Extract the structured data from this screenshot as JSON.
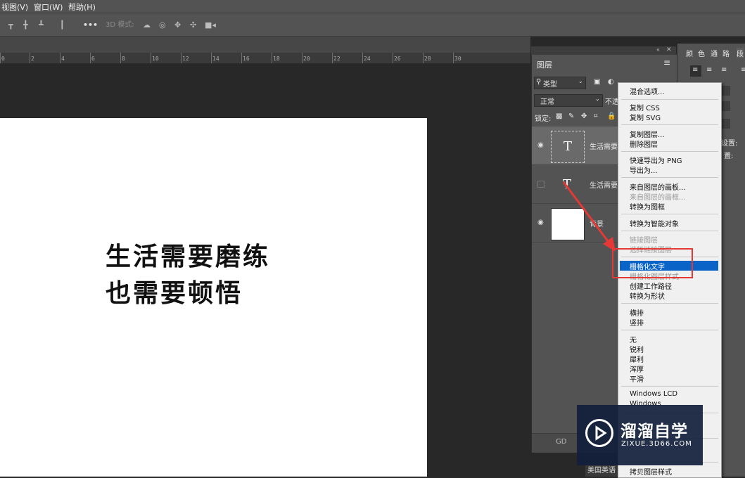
{
  "menubar": {
    "items": [
      "视图(V)",
      "窗口(W)",
      "帮助(H)"
    ]
  },
  "optionsbar": {
    "more_label": "•••",
    "mode_3d_label": "3D 模式:"
  },
  "ruler": {
    "ticks": [
      "0",
      "2",
      "4",
      "6",
      "8",
      "10",
      "12",
      "14",
      "16",
      "18",
      "20",
      "22",
      "24",
      "26",
      "28",
      "30"
    ]
  },
  "document": {
    "line1": "生活需要磨练",
    "line2": "也需要顿悟"
  },
  "layers_panel": {
    "title": "图层",
    "filter_kind": "类型",
    "blend_mode": "正常",
    "opacity_label": "不透",
    "lock_label": "锁定:",
    "layers": [
      {
        "name": "生活需要",
        "thumb": "T"
      },
      {
        "name": "生活需要",
        "thumb": "T"
      },
      {
        "name": "背景",
        "thumb": ""
      }
    ],
    "link_icon_label": "GD"
  },
  "right_panel": {
    "tabs": [
      "颜",
      "色",
      "通",
      "路",
      "段"
    ],
    "setting1": "设置:",
    "setting2": "置:"
  },
  "context_menu": {
    "items": [
      "混合选项...",
      "复制 CSS",
      "复制 SVG",
      "复制图层...",
      "删除图层",
      "快速导出为 PNG",
      "导出为...",
      "来自图层的画板...",
      "来自图层的画框...",
      "转换为图框",
      "转换为智能对象",
      "链接图层",
      "选择链接图层",
      "栅格化文字",
      "栅格化图层样式",
      "创建工作路径",
      "转换为形状",
      "横排",
      "竖排",
      "无",
      "锐利",
      "犀利",
      "浑厚",
      "平滑",
      "Windows LCD",
      "Windows",
      "拷贝图层样式"
    ]
  },
  "language_tag": "美国英语",
  "watermark": {
    "title": "溜溜自学",
    "url": "ZIXUE.3D66.COM"
  },
  "colors": {
    "highlight": "#0a64c8",
    "annotation": "#e53935",
    "panel_bg": "#535353"
  }
}
